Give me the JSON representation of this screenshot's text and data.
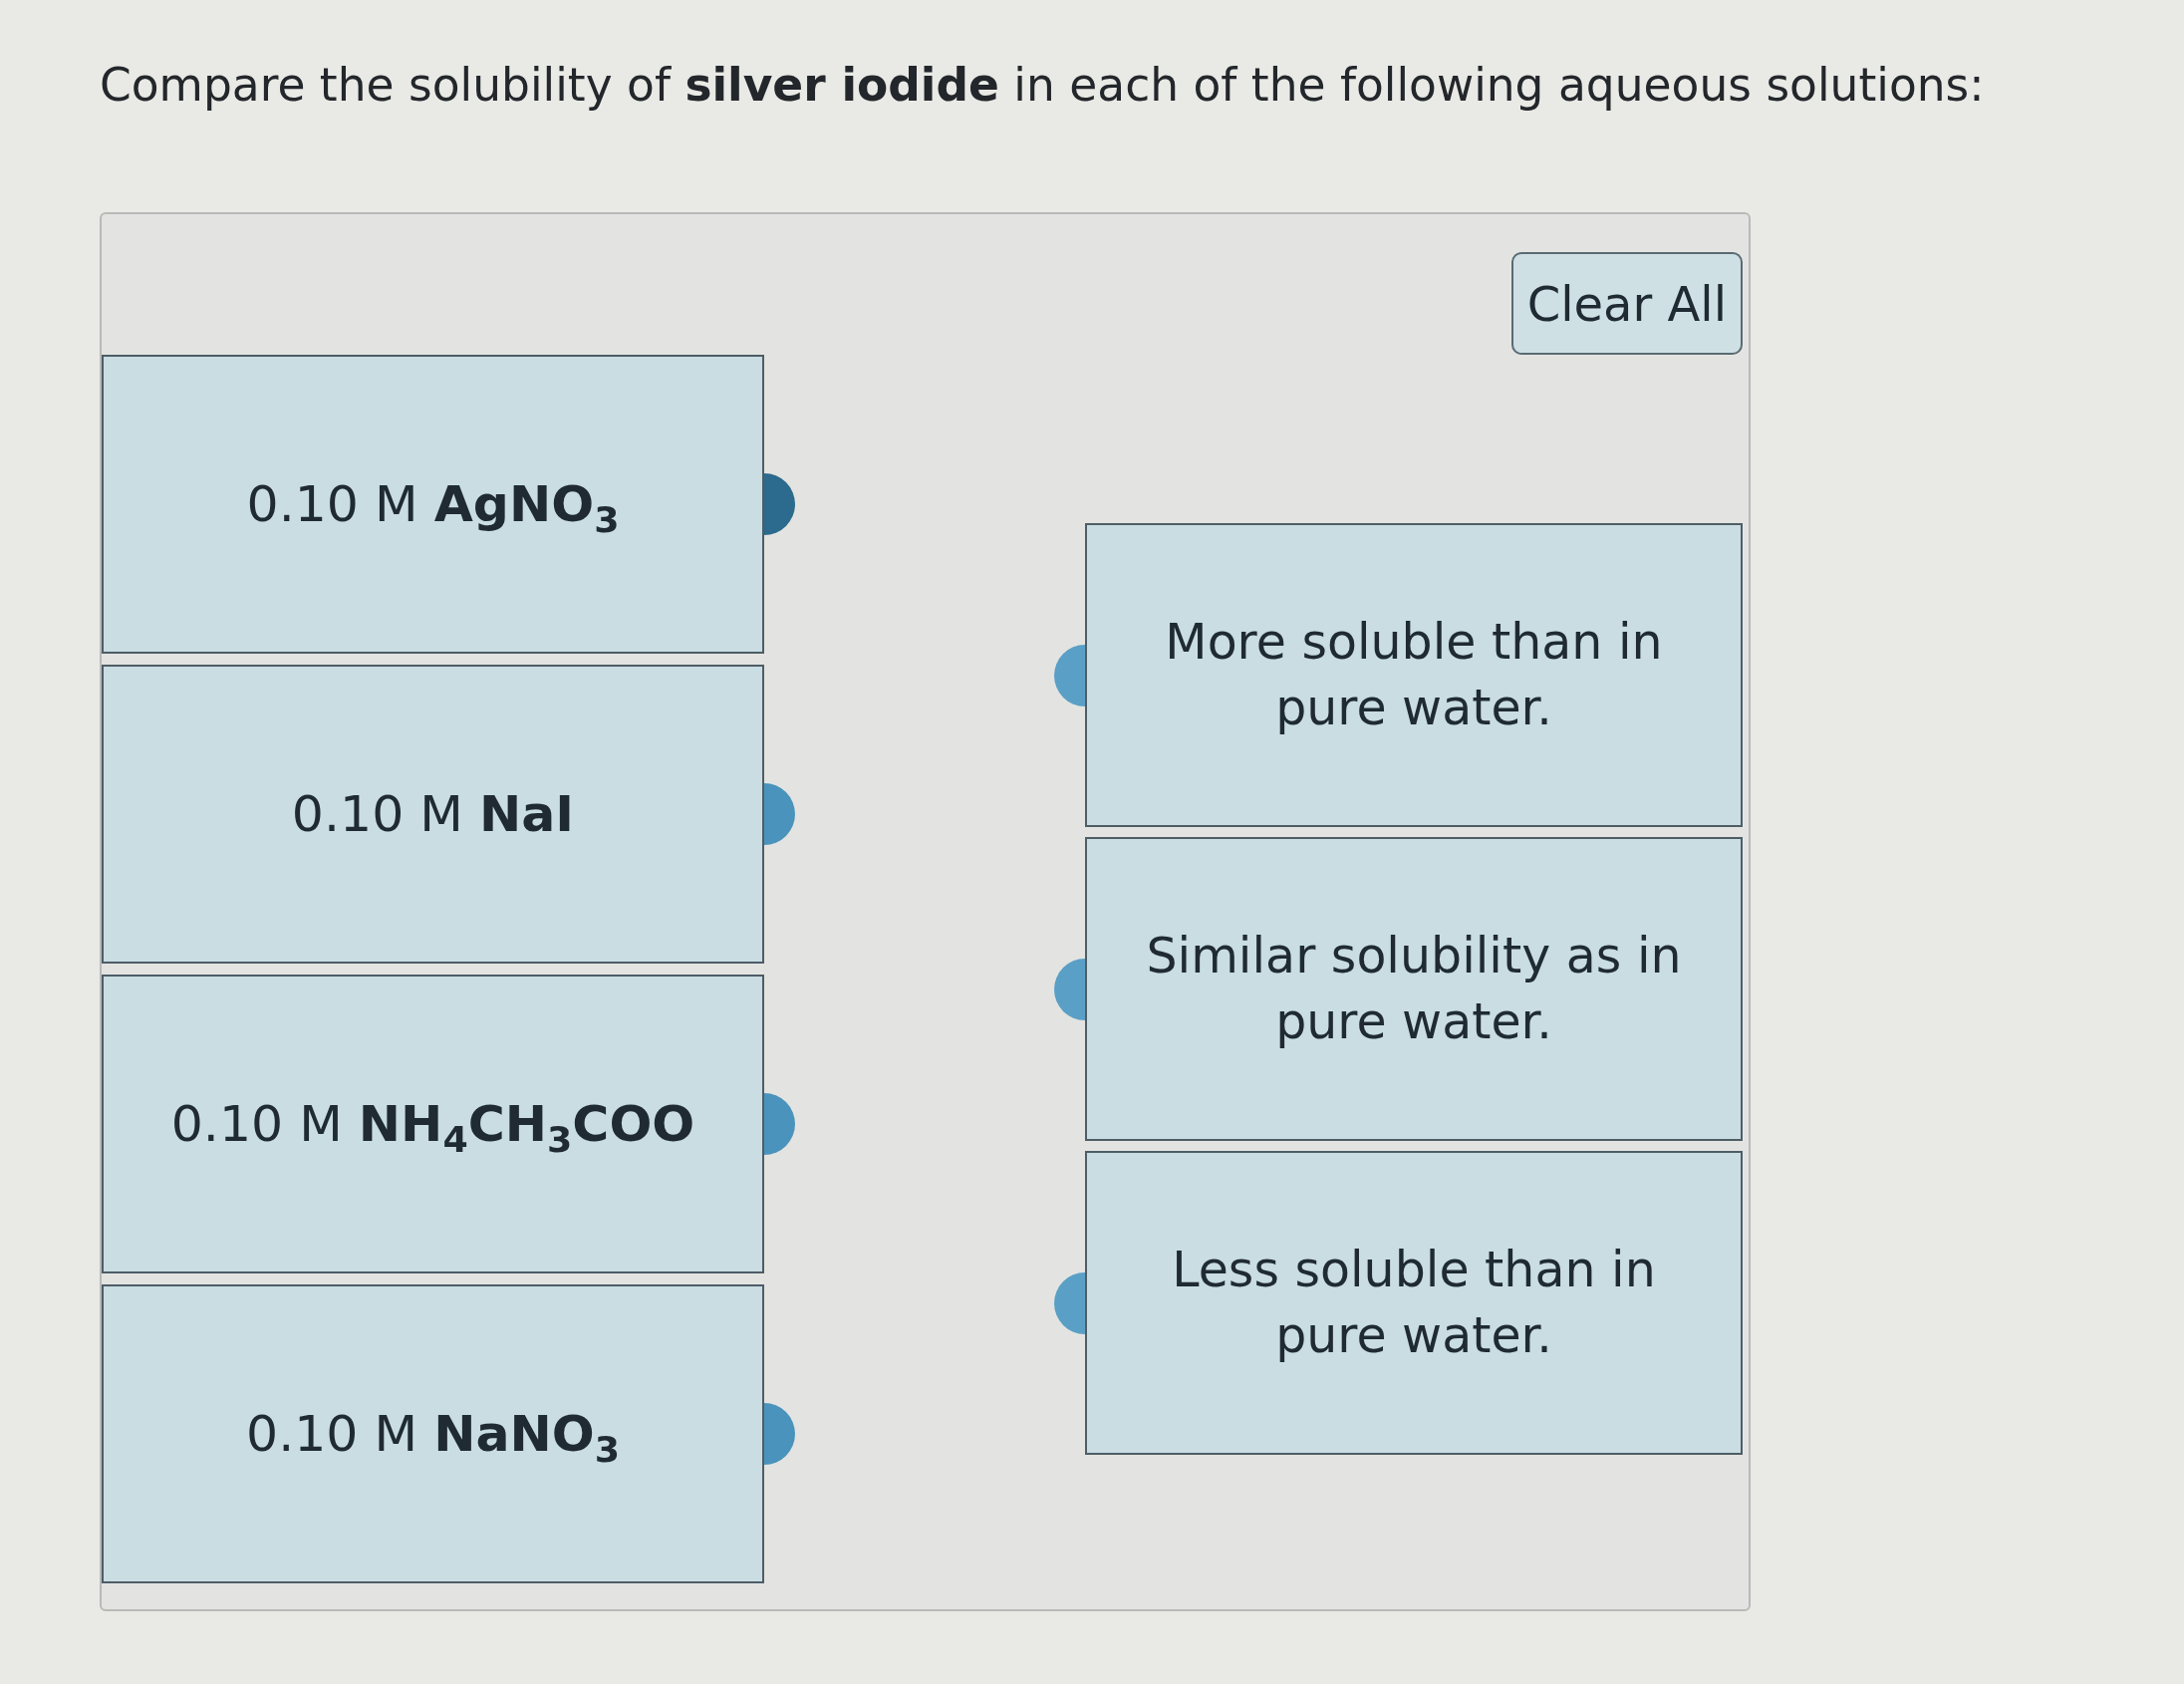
{
  "question": {
    "text": "Compare the solubility of **silver iodide** in each of the following aqueous solutions:"
  },
  "clear_button": {
    "label": "Clear All"
  },
  "solutions": [
    {
      "label": "0.10 M **AgNO**$_{3}$",
      "selected": true
    },
    {
      "label": "0.10 M **NaI**",
      "selected": false
    },
    {
      "label": "0.10 M **NH**$_{4}$**CH**$_{3}$**COO**",
      "selected": false
    },
    {
      "label": "0.10 M **NaNO**$_{3}$",
      "selected": false
    }
  ],
  "categories": [
    {
      "label": "More soluble than in pure water.",
      "selected": false
    },
    {
      "label": "Similar solubility as in pure water.",
      "selected": false
    },
    {
      "label": "Less soluble than in pure water.",
      "selected": false
    }
  ]
}
